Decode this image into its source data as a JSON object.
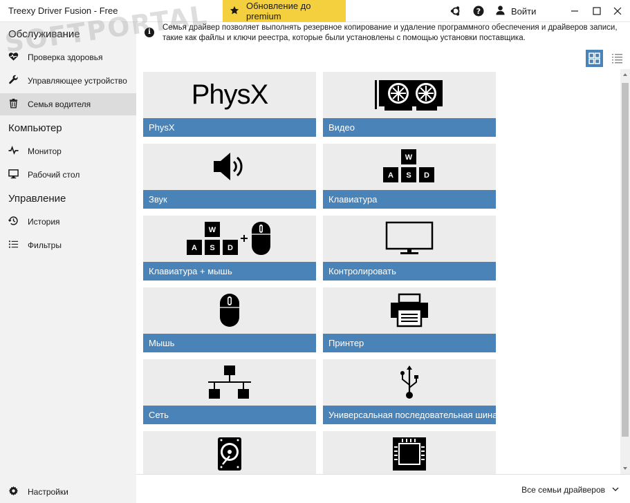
{
  "titlebar": {
    "app_title": "Treexy Driver Fusion - Free",
    "premium_label": "Обновление до premium",
    "login_label": "Войти"
  },
  "sidebar": {
    "sections": [
      {
        "title": "Обслуживание"
      },
      {
        "title": "Компьютер"
      },
      {
        "title": "Управление"
      }
    ],
    "items": [
      {
        "label": "Проверка здоровья",
        "icon": "heart-icon"
      },
      {
        "label": "Управляющее устройство",
        "icon": "wrench-icon"
      },
      {
        "label": "Семья водителя",
        "icon": "trash-icon",
        "active": true
      },
      {
        "label": "Монитор",
        "icon": "pulse-icon"
      },
      {
        "label": "Рабочий стол",
        "icon": "desktop-icon"
      },
      {
        "label": "История",
        "icon": "history-icon"
      },
      {
        "label": "Фильтры",
        "icon": "list-icon"
      }
    ],
    "settings_label": "Настройки"
  },
  "main": {
    "description": "Семья драйвер позволяет выполнять резервное копирование и удаление программного обеспечения и драйверов записи, такие как файлы и ключи реестра, которые были установлены с помощью установки поставщика.",
    "tiles": [
      {
        "label": "PhysX",
        "icon": "physx-icon"
      },
      {
        "label": "Видео",
        "icon": "video-card-icon"
      },
      {
        "label": "Звук",
        "icon": "speaker-icon"
      },
      {
        "label": "Клавиатура",
        "icon": "keyboard-icon"
      },
      {
        "label": "Клавиатура + мышь",
        "icon": "keyboard-mouse-icon"
      },
      {
        "label": "Контролировать",
        "icon": "monitor-icon"
      },
      {
        "label": "Мышь",
        "icon": "mouse-icon"
      },
      {
        "label": "Принтер",
        "icon": "printer-icon"
      },
      {
        "label": "Сеть",
        "icon": "network-icon"
      },
      {
        "label": "Универсальная последовательная шина",
        "icon": "usb-icon"
      },
      {
        "label": "",
        "icon": "hard-disk-icon"
      },
      {
        "label": "",
        "icon": "chip-icon"
      }
    ],
    "physx_logo_text": "PhysX",
    "keyboard_keys": [
      "W",
      "A",
      "S",
      "D"
    ],
    "footer_filter": "Все семьи драйверов"
  },
  "colors": {
    "accent": "#4a83b8",
    "premium": "#f4d03f",
    "sidebar_bg": "#f2f2f2",
    "tile_bg": "#ececec"
  }
}
